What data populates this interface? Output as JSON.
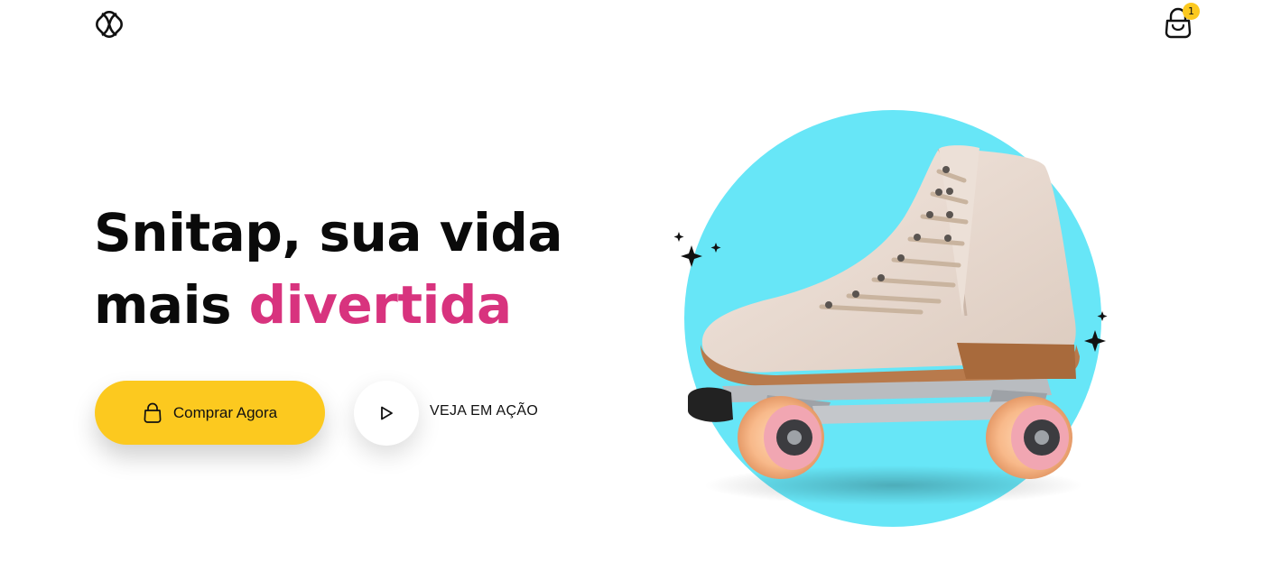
{
  "header": {
    "logo_icon": "snitap-logo-icon",
    "cart_icon": "shopping-bag-icon",
    "cart_count": "1"
  },
  "hero": {
    "headline_line1": "Snitap, sua vida",
    "headline_line2_plain": "mais ",
    "headline_line2_accent": "divertida",
    "buy_button_label": "Comprar Agora",
    "buy_button_icon": "shopping-bag-icon",
    "play_button_icon": "play-icon",
    "play_label": "VEJA EM AÇÃO",
    "image_subject": "roller-skate-icon"
  },
  "colors": {
    "accent_pink": "#d8337e",
    "button_yellow": "#fcc91f",
    "circle_cyan": "#67e6f7",
    "badge_yellow": "#fcc91f",
    "text_dark": "#0a0a0a"
  }
}
